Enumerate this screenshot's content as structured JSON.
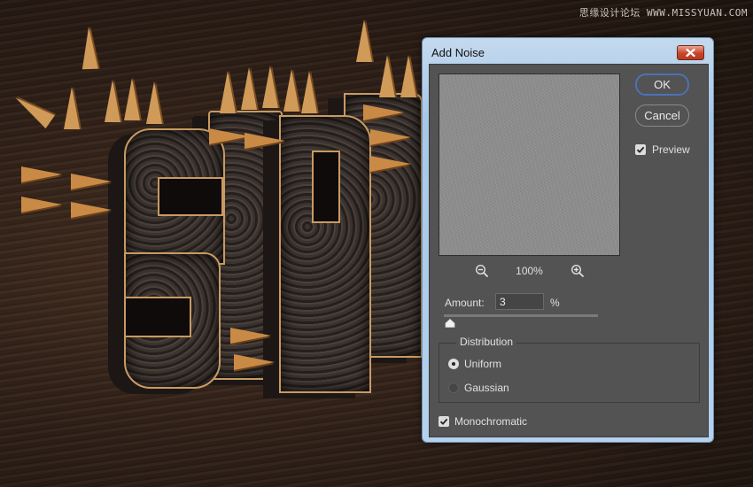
{
  "watermark": "思缘设计论坛 WWW.MISSYUAN.COM",
  "dialog": {
    "title": "Add Noise",
    "close_icon": "close-icon",
    "preview": {
      "zoom_level": "100%",
      "zoom_out_icon": "zoom-out-icon",
      "zoom_in_icon": "zoom-in-icon"
    },
    "buttons": {
      "ok_label": "OK",
      "cancel_label": "Cancel"
    },
    "preview_checkbox": {
      "label": "Preview",
      "checked": true
    },
    "amount": {
      "label": "Amount:",
      "value": "3",
      "unit": "%",
      "slider_fraction": 0.03
    },
    "distribution": {
      "legend": "Distribution",
      "options": [
        {
          "label": "Uniform",
          "selected": true
        },
        {
          "label": "Gaussian",
          "selected": false
        }
      ]
    },
    "monochromatic": {
      "label": "Monochromatic",
      "checked": true
    }
  },
  "colors": {
    "dialog_frame": "#b4d1ee",
    "content_bg": "#535353",
    "ok_border": "#4a72b8",
    "close_button": "#c8452c"
  }
}
